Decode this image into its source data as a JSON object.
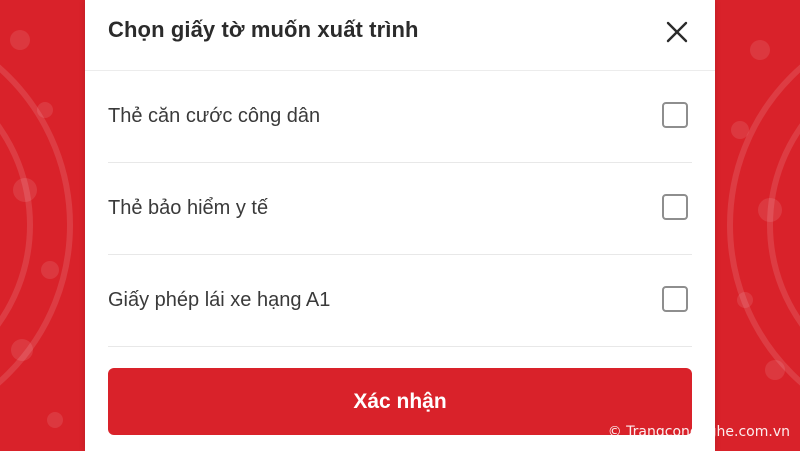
{
  "dialog": {
    "title": "Chọn giấy tờ muốn xuất trình",
    "close_icon": "close-icon"
  },
  "options": [
    {
      "label": "Thẻ căn cước công dân",
      "checked": false
    },
    {
      "label": "Thẻ bảo hiểm y tế",
      "checked": false
    },
    {
      "label": "Giấy phép lái xe hạng A1",
      "checked": false
    }
  ],
  "confirm": {
    "label": "Xác nhận"
  },
  "watermark": {
    "text": "© Trangcongnghe.com.vn"
  },
  "colors": {
    "accent": "#d9222a",
    "background_red": "#d9222a"
  }
}
